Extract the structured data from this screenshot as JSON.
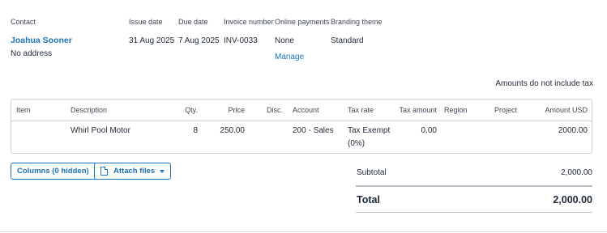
{
  "header": {
    "contact_label": "Contact",
    "contact_name": "Joahua Sooner",
    "contact_address": "No address",
    "issue_date_label": "Issue date",
    "issue_date": "31 Aug 2025",
    "due_date_label": "Due date",
    "due_date": "7 Aug 2025",
    "invoice_number_label": "Invoice number",
    "invoice_number": "INV-0033",
    "online_payments_label": "Online payments",
    "online_payments": "None",
    "manage_link": "Manage",
    "branding_theme_label": "Branding theme",
    "branding_theme": "Standard"
  },
  "tax_note": "Amounts do not include tax",
  "table": {
    "columns": [
      "Item",
      "Description",
      "Qty.",
      "Price",
      "Disc.",
      "Account",
      "Tax rate",
      "Tax amount",
      "Region",
      "Project",
      "Amount USD"
    ],
    "rows": [
      {
        "item": "",
        "description": "Whirl Pool Motor",
        "qty": "8",
        "price": "250.00",
        "disc": "",
        "account": "200 - Sales",
        "tax_rate_line1": "Tax Exempt",
        "tax_rate_line2": "(0%)",
        "tax_amount": "0.00",
        "region": "",
        "project": "",
        "amount": "2000.00"
      }
    ]
  },
  "actions": {
    "columns_button": "Columns (0 hidden)",
    "attach_button": "Attach files"
  },
  "totals": {
    "subtotal_label": "Subtotal",
    "subtotal_value": "2,000.00",
    "total_label": "Total",
    "total_value": "2,000.00"
  },
  "colors": {
    "accent": "#1a73b8",
    "border": "#cfd3da",
    "text": "#1f2937"
  }
}
